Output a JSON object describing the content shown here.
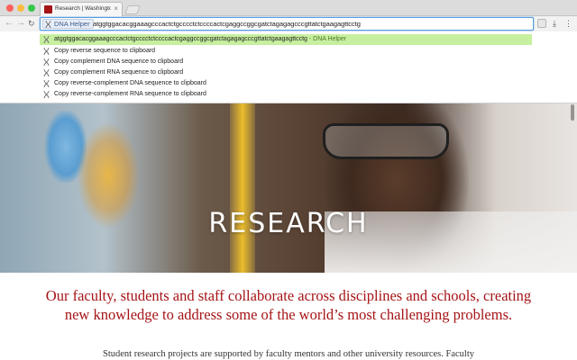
{
  "browser": {
    "tab": {
      "title": "Research | Washington Uni"
    },
    "omnibox": {
      "keyword": "DNA Helper",
      "text": "atggtggacacggaaagcccactctgcccctctccccactcgaggccggcgatctagagagcccgttatctgaagagttcctg"
    }
  },
  "suggestions": [
    {
      "text": "atggtggacacggaaagcccactctgcccctctccccactcgaggccggcgatctagagagcccgttatctgaagagttcctg",
      "suffix": " - DNA Helper",
      "selected": true
    },
    {
      "text": "Copy reverse sequence to clipboard",
      "suffix": "",
      "selected": false
    },
    {
      "text": "Copy complement DNA sequence to clipboard",
      "suffix": "",
      "selected": false
    },
    {
      "text": "Copy complement RNA sequence to clipboard",
      "suffix": "",
      "selected": false
    },
    {
      "text": "Copy reverse-complement DNA sequence to clipboard",
      "suffix": "",
      "selected": false
    },
    {
      "text": "Copy reverse-complement RNA sequence to clipboard",
      "suffix": "",
      "selected": false
    }
  ],
  "page": {
    "hero_title": "RESEARCH",
    "lead": "Our faculty, students and staff collaborate across disciplines and schools, creating new knowledge to address some of the world’s most challenging problems.",
    "body": "Student research projects are supported by faculty mentors and other university resources. Faculty"
  },
  "colors": {
    "brand_red": "#a51417",
    "selected_suggestion": "#c6ef9f"
  },
  "icons": {
    "suggestion": "dna-helper-icon"
  }
}
